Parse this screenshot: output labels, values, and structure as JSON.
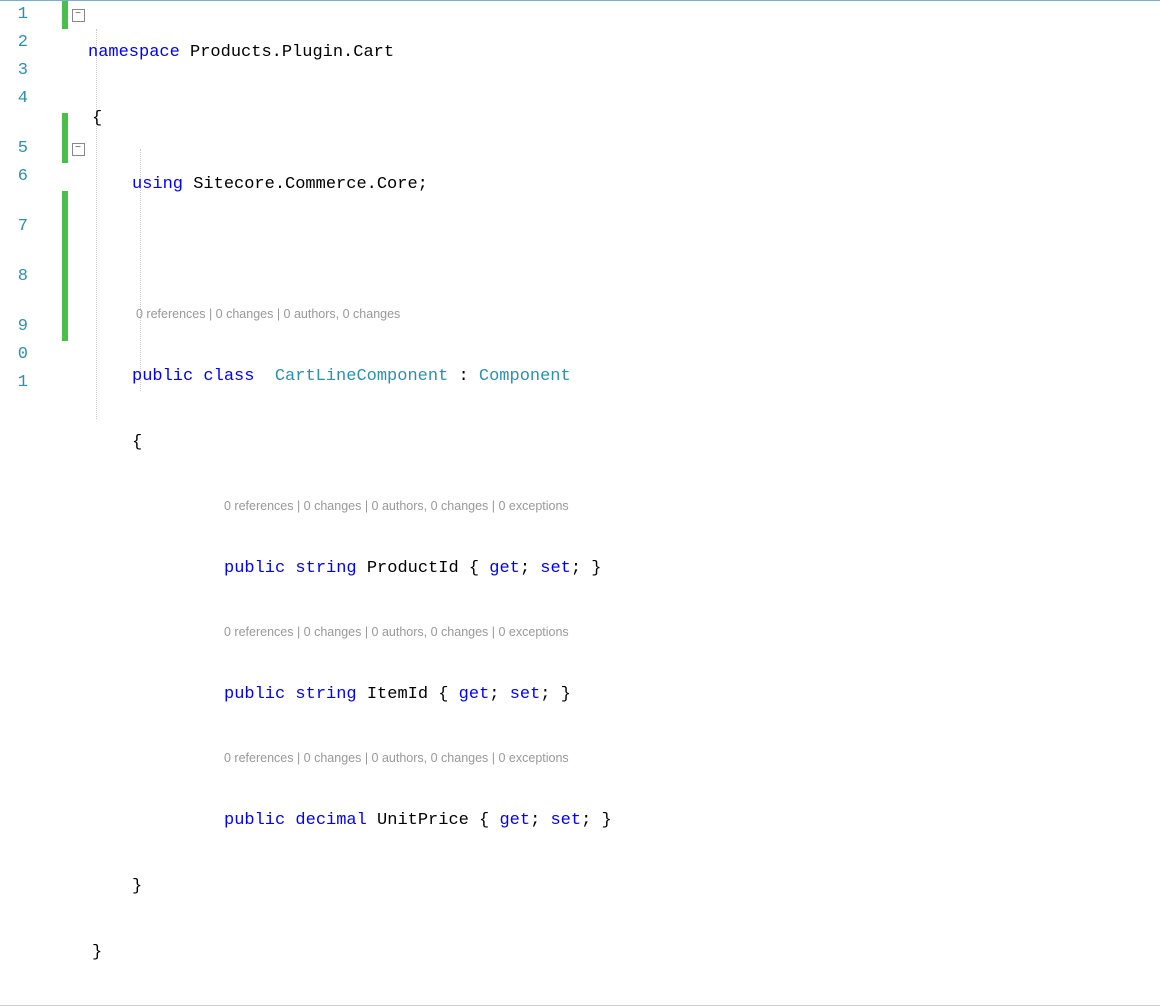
{
  "lineNumbers": [
    "1",
    "2",
    "3",
    "4",
    "5",
    "6",
    "7",
    "8",
    "9",
    "0",
    "1"
  ],
  "code": {
    "ns_kw": "namespace",
    "ns_name": " Products.Plugin.Cart",
    "openBrace": "{",
    "using_kw": "using",
    "using_name": " Sitecore.Commerce.Core;",
    "lens_class": "0 references | 0 changes | 0 authors, 0 changes",
    "public_kw": "public",
    "class_kw": "class",
    "class_name": "CartLineComponent",
    "colon": " : ",
    "base_type": "Component",
    "lens_prop": "0 references | 0 changes | 0 authors, 0 changes | 0 exceptions",
    "string_kw": "string",
    "decimal_kw": "decimal",
    "prop1": " ProductId { ",
    "prop2": " ItemId { ",
    "prop3": " UnitPrice { ",
    "get_kw": "get",
    "set_kw": "set",
    "semiBrace": "; ",
    "closeAcc": "; }",
    "closeBrace": "}"
  }
}
